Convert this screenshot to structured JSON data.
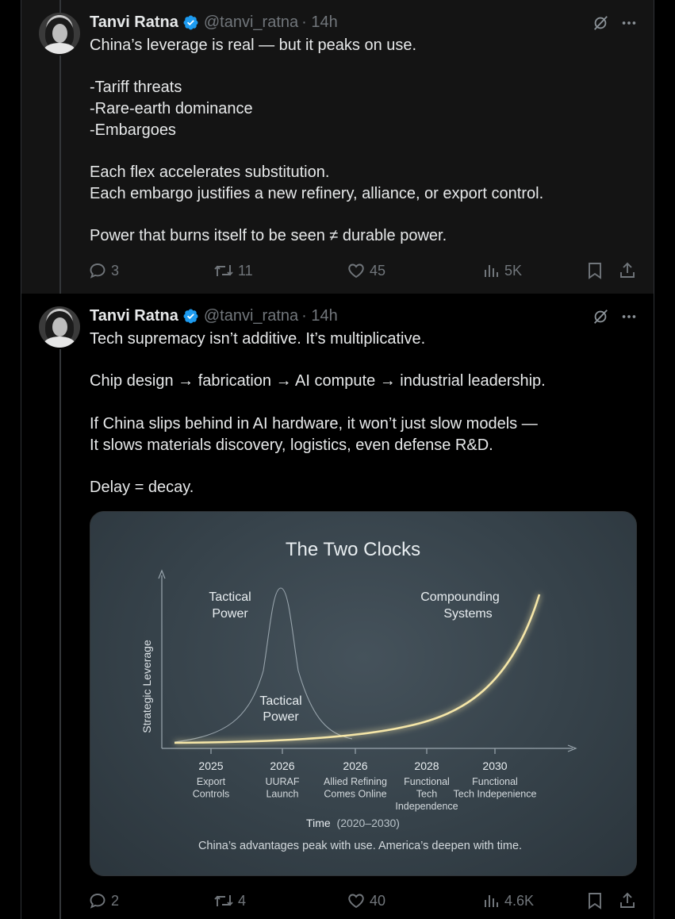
{
  "tweets": [
    {
      "author": {
        "name": "Tanvi Ratna",
        "handle": "@tanvi_ratna",
        "time": "· 14h"
      },
      "text": "China’s leverage is real — but it peaks on use.\n\n-Tariff threats\n-Rare-earth dominance\n-Embargoes\n\nEach flex accelerates substitution.\nEach embargo justifies a new refinery, alliance, or export control.\n\nPower that burns itself to be seen ≠ durable power.",
      "stats": {
        "replies": "3",
        "reposts": "11",
        "likes": "45",
        "views": "5K"
      }
    },
    {
      "author": {
        "name": "Tanvi Ratna",
        "handle": "@tanvi_ratna",
        "time": "· 14h"
      },
      "text": "Tech supremacy isn’t additive. It’s multiplicative.\n\nChip design → fabrication → AI compute → industrial leadership.\n\nIf China slips behind in AI hardware, it won’t just slow models —\nIt slows materials discovery, logistics, even defense R&D.\n\nDelay = decay.",
      "stats": {
        "replies": "2",
        "reposts": "4",
        "likes": "40",
        "views": "4.6K"
      },
      "image": {
        "title": "The Two Clocks",
        "ylabel": "Strategic Leverage",
        "xlabel_main": "Time",
        "xlabel_range": "(2020–2030)",
        "caption": "China’s advantages peak with use. America’s deepen with time.",
        "label_tactical_top": [
          "Tactical",
          "Power"
        ],
        "label_tactical_mid": [
          "Tactical",
          "Power"
        ],
        "label_compounding": [
          "Compounding",
          "Systems"
        ],
        "ticks": [
          {
            "year": "2025",
            "lines": [
              "Export",
              "Controls"
            ]
          },
          {
            "year": "2026",
            "lines": [
              "UURAF",
              "Launch"
            ]
          },
          {
            "year": "2026",
            "lines": [
              "Allied Refining",
              "Comes Online"
            ]
          },
          {
            "year": "2028",
            "lines": [
              "Functional",
              "Tech",
              "Independence"
            ]
          },
          {
            "year": "2030",
            "lines": [
              "Functional",
              "Tech Indepenience"
            ]
          }
        ],
        "colors": {
          "curve_glow": "#f5e6a8",
          "bell": "#a7b3bb",
          "axis": "#9aa6ae",
          "text": "#e9eef1"
        }
      }
    }
  ],
  "chart_data": {
    "type": "line",
    "title": "The Two Clocks",
    "xlabel": "Time (2020–2030)",
    "ylabel": "Strategic Leverage",
    "categories": [
      "2025",
      "2026",
      "2026",
      "2028",
      "2030"
    ],
    "series": [
      {
        "name": "Tactical Power",
        "values": [
          0.05,
          1.0,
          0.05,
          0.0,
          0.0
        ]
      },
      {
        "name": "Compounding Systems",
        "values": [
          0.0,
          0.02,
          0.1,
          0.3,
          0.7
        ]
      }
    ],
    "grid": false
  }
}
